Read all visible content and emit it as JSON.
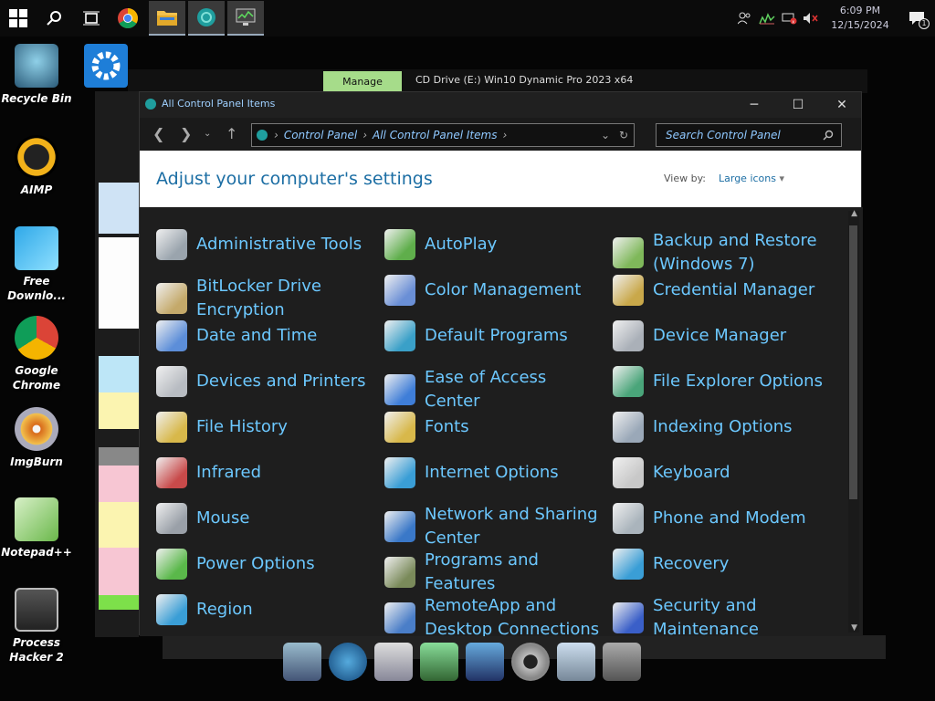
{
  "taskbar": {
    "tray_icons": [
      "people-icon",
      "network-activity-icon",
      "network-disconnected-icon",
      "volume-muted-icon"
    ],
    "time": "6:09 PM",
    "date": "12/15/2024",
    "notification_count": "1"
  },
  "desktop": {
    "icons": [
      {
        "label": "Recycle Bin"
      },
      {
        "label": "AIMP"
      },
      {
        "label": "Free\nDownlo..."
      },
      {
        "label": "Google\nChrome"
      },
      {
        "label": "ImgBurn"
      },
      {
        "label": "Notepad++"
      },
      {
        "label": "Process\nHacker 2"
      }
    ]
  },
  "background_window": {
    "manage_label": "Manage",
    "title": "CD Drive (E:) Win10 Dynamic Pro 2023 x64"
  },
  "control_panel": {
    "title": "All Control Panel Items",
    "breadcrumb": [
      "Control Panel",
      "All Control Panel Items"
    ],
    "search_placeholder": "Search Control Panel",
    "heading": "Adjust your computer's settings",
    "view_by_label": "View by:",
    "view_by_value": "Large icons",
    "items": [
      {
        "label": "Administrative Tools",
        "icon": "tools-icon",
        "color": "#9aa4ad"
      },
      {
        "label": "AutoPlay",
        "icon": "autoplay-icon",
        "color": "#5fae4b"
      },
      {
        "label": "Backup and Restore (Windows 7)",
        "icon": "backup-icon",
        "color": "#7fb85a"
      },
      {
        "label": "BitLocker Drive Encryption",
        "icon": "bitlocker-icon",
        "color": "#c4a96a"
      },
      {
        "label": "Color Management",
        "icon": "color-management-icon",
        "color": "#6a8fd6"
      },
      {
        "label": "Credential Manager",
        "icon": "credential-icon",
        "color": "#c9a84a"
      },
      {
        "label": "Date and Time",
        "icon": "calendar-icon",
        "color": "#5c8ed9"
      },
      {
        "label": "Default Programs",
        "icon": "default-programs-icon",
        "color": "#3aa0c8"
      },
      {
        "label": "Device Manager",
        "icon": "device-manager-icon",
        "color": "#aab0b8"
      },
      {
        "label": "Devices and Printers",
        "icon": "printer-icon",
        "color": "#b8bcc2"
      },
      {
        "label": "Ease of Access Center",
        "icon": "ease-of-access-icon",
        "color": "#3f7ed8"
      },
      {
        "label": "File Explorer Options",
        "icon": "folder-options-icon",
        "color": "#4aa57a"
      },
      {
        "label": "File History",
        "icon": "file-history-icon",
        "color": "#d8b84a"
      },
      {
        "label": "Fonts",
        "icon": "fonts-icon",
        "color": "#d8b84a"
      },
      {
        "label": "Indexing Options",
        "icon": "indexing-icon",
        "color": "#9aa8b8"
      },
      {
        "label": "Infrared",
        "icon": "infrared-icon",
        "color": "#c84a4a"
      },
      {
        "label": "Internet Options",
        "icon": "internet-options-icon",
        "color": "#3a9ed6"
      },
      {
        "label": "Keyboard",
        "icon": "keyboard-icon",
        "color": "#c8c8c8"
      },
      {
        "label": "Mouse",
        "icon": "mouse-icon",
        "color": "#9aa0a8"
      },
      {
        "label": "Network and Sharing Center",
        "icon": "network-icon",
        "color": "#3a78c8"
      },
      {
        "label": "Phone and Modem",
        "icon": "phone-icon",
        "color": "#aab4bc"
      },
      {
        "label": "Power Options",
        "icon": "power-icon",
        "color": "#5ab84a"
      },
      {
        "label": "Programs and Features",
        "icon": "programs-icon",
        "color": "#7a8a5a"
      },
      {
        "label": "Recovery",
        "icon": "recovery-icon",
        "color": "#3a9ed6"
      },
      {
        "label": "Region",
        "icon": "region-icon",
        "color": "#3a9ed6"
      },
      {
        "label": "RemoteApp and Desktop Connections",
        "icon": "remoteapp-icon",
        "color": "#4a7ec8"
      },
      {
        "label": "Security and Maintenance",
        "icon": "security-flag-icon",
        "color": "#3a5fc8"
      }
    ]
  }
}
